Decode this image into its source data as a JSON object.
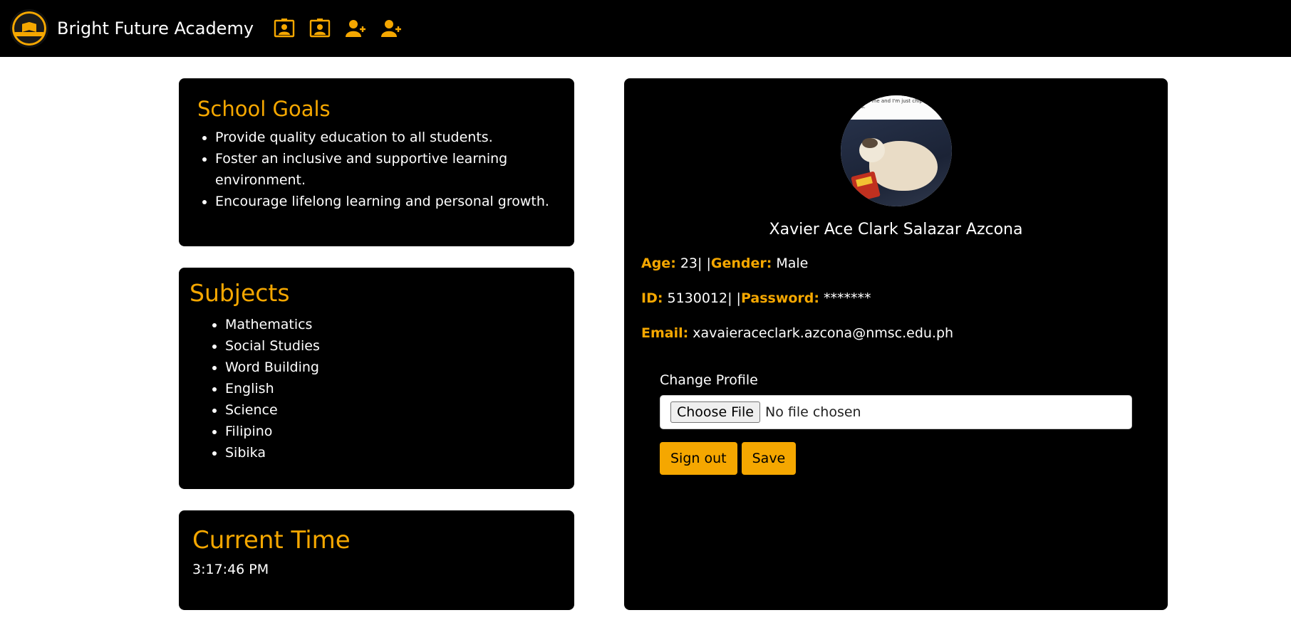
{
  "brand": {
    "name": "Bright Future Academy"
  },
  "nav": {
    "icons": [
      "teacher-board-icon",
      "student-board-icon",
      "add-user-icon",
      "add-user-icon"
    ]
  },
  "goals": {
    "title": "School Goals",
    "items": [
      "Provide quality education to all students.",
      "Foster an inclusive and supportive learning environment.",
      "Encourage lifelong learning and personal growth."
    ]
  },
  "subjects": {
    "title": "Subjects",
    "items": [
      "Mathematics",
      "Social Studies",
      "Word Building",
      "English",
      "Science",
      "Filipino",
      "Sibika"
    ]
  },
  "time": {
    "title": "Current Time",
    "value": "3:17:46 PM"
  },
  "profile": {
    "photo_caption": "ing on me and I'm just chips like this.",
    "name": "Xavier Ace Clark Salazar Azcona",
    "age_label": "Age:",
    "age_value": " 23| |",
    "gender_label": "Gender:",
    "gender_value": " Male",
    "id_label": "ID:",
    "id_value": " 5130012| |",
    "password_label": "Password:",
    "password_value": " *******",
    "email_label": "Email:",
    "email_value": " xavaieraceclark.azcona@nmsc.edu.ph",
    "change_label": "Change Profile",
    "choose_file": "Choose File",
    "no_file": "No file chosen",
    "signout_label": "Sign out",
    "save_label": "Save"
  },
  "colors": {
    "accent": "#f5a700",
    "card": "#000000",
    "background": "#ffffff"
  }
}
